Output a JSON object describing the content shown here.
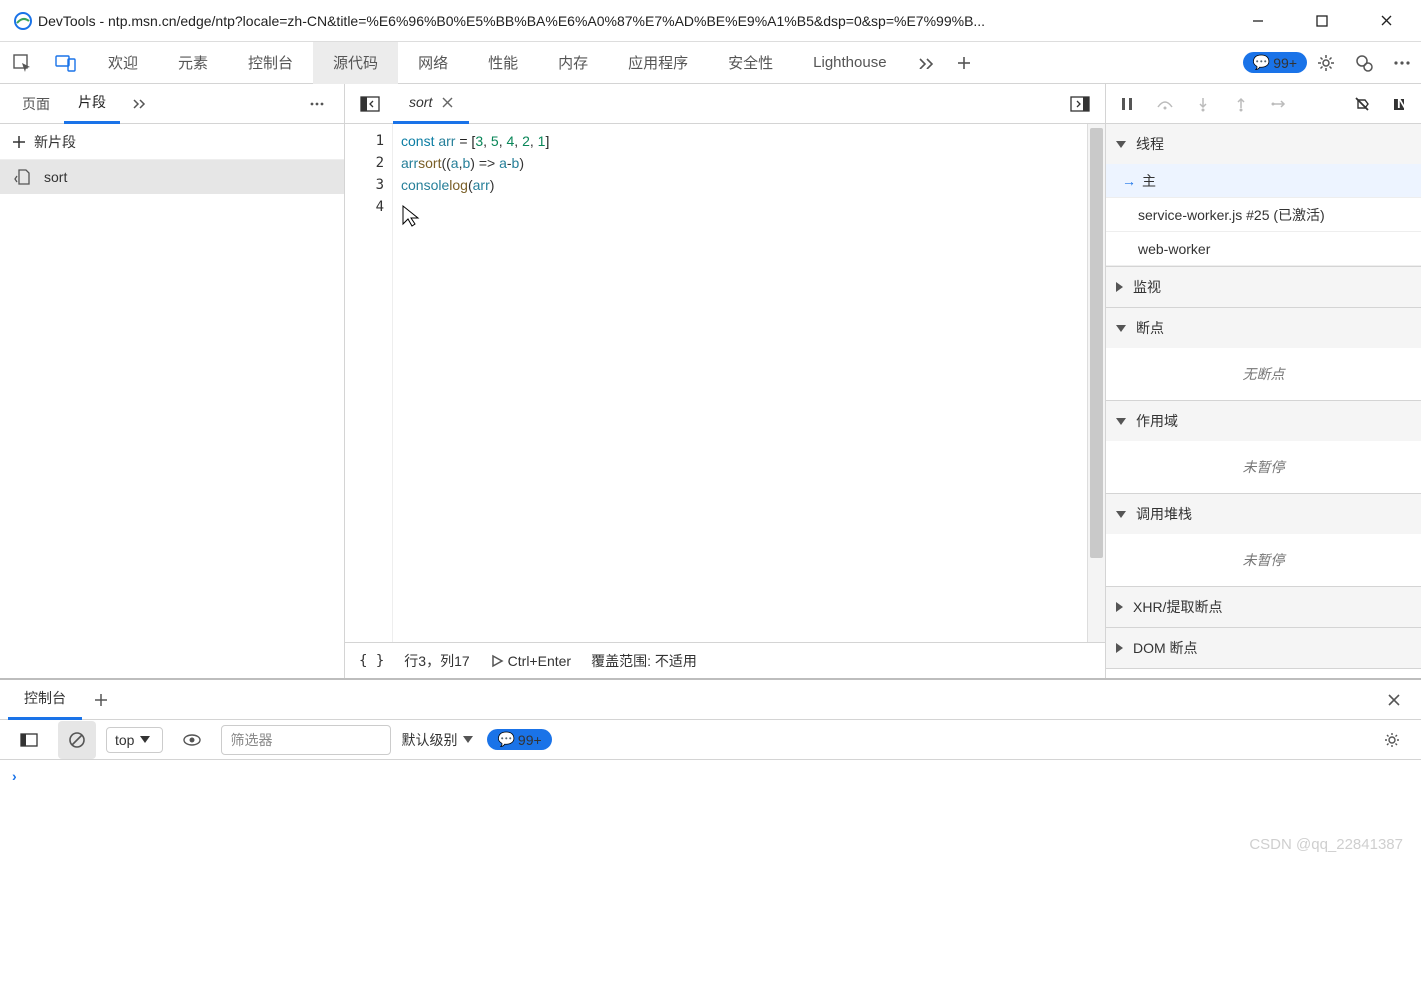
{
  "window": {
    "title": "DevTools - ntp.msn.cn/edge/ntp?locale=zh-CN&title=%E6%96%B0%E5%BB%BA%E6%A0%87%E7%AD%BE%E9%A1%B5&dsp=0&sp=%E7%99%B..."
  },
  "maintabs": {
    "welcome": "欢迎",
    "elements": "元素",
    "console": "控制台",
    "sources": "源代码",
    "network": "网络",
    "performance": "性能",
    "memory": "内存",
    "application": "应用程序",
    "security": "安全性",
    "lighthouse": "Lighthouse"
  },
  "issue_badge": "99+",
  "left": {
    "pages": "页面",
    "snippets": "片段",
    "new_snippet": "新片段",
    "snippet_name": "sort"
  },
  "editor": {
    "filetab": "sort",
    "lines": [
      "1",
      "2",
      "3",
      "4"
    ],
    "code": {
      "l1a": "const ",
      "l1b": "arr ",
      "l1c": "= [",
      "l1d": "3",
      "l1e": ", ",
      "l1f": "5",
      "l1g": ", ",
      "l1h": "4",
      "l1i": ", ",
      "l1j": "2",
      "l1k": ", ",
      "l1l": "1",
      "l1m": "]",
      "l2a": "arr",
      ".s": ".",
      "l2b": "sort",
      "l2c": "((",
      "l2d": "a",
      "l2e": ",",
      "l2f": "b",
      "l2g": ") => ",
      "l2h": "a",
      "l2i": "-",
      "l2j": "b",
      "l2k": ")",
      "l3a": "console",
      ".s2": ".",
      "l3b": "log",
      "l3c": "(",
      "l3d": "arr",
      "l3e": ")"
    },
    "status": {
      "braces": "{ }",
      "pos": "行3，列17",
      "run": "Ctrl+Enter",
      "coverage": "覆盖范围: 不适用"
    }
  },
  "debug": {
    "threads_hdr": "线程",
    "thr_main": "主",
    "thr_sw": "service-worker.js #25 (已激活)",
    "thr_ww": "web-worker",
    "watch": "监视",
    "breakpoints": "断点",
    "no_bp": "无断点",
    "scope": "作用域",
    "not_paused": "未暂停",
    "callstack": "调用堆栈",
    "not_paused2": "未暂停",
    "xhr": "XHR/提取断点",
    "dom": "DOM 断点"
  },
  "lower": {
    "console_tab": "控制台",
    "ctx": "top",
    "filter_ph": "筛选器",
    "level": "默认级别",
    "badge": "99+"
  },
  "watermark": "CSDN @qq_22841387"
}
